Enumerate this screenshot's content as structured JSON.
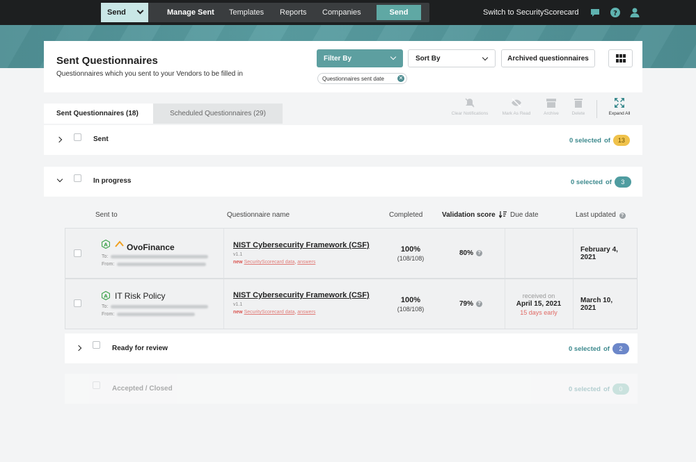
{
  "topnav": {
    "send_dropdown": "Send",
    "links": [
      "Manage Sent",
      "Templates",
      "Reports",
      "Companies"
    ],
    "send_button": "Send",
    "switch_link": "Switch to SecurityScorecard",
    "icons": [
      "chat-icon",
      "help-icon",
      "user-icon"
    ]
  },
  "header": {
    "title": "Sent Questionnaires",
    "subtitle": "Questionnaires which you sent to your Vendors to be filled in",
    "filter_by": "Filter By",
    "sort_by": "Sort By",
    "archived": "Archived questionnaires",
    "filter_chip": "Questionnaires sent date"
  },
  "tabs": {
    "sent": "Sent Questionnaires (18)",
    "scheduled": "Scheduled Questionnaires (29)"
  },
  "toolbar": {
    "clear_notifications": "Clear Notifications",
    "mark_as_read": "Mark As Read",
    "archive": "Archive",
    "delete": "Delete",
    "expand_all": "Expand All"
  },
  "groups": {
    "sent": {
      "label": "Sent",
      "selected": "0 selected",
      "of": "of",
      "count": "13"
    },
    "in_progress": {
      "label": "In progress",
      "selected": "0 selected",
      "of": "of",
      "count": "3"
    },
    "ready": {
      "label": "Ready for review",
      "selected": "0 selected",
      "of": "of",
      "count": "2"
    },
    "accepted": {
      "label": "Accepted / Closed",
      "selected": "0 selected",
      "of": "of",
      "count": "0"
    }
  },
  "table": {
    "headers": {
      "sent_to": "Sent to",
      "questionnaire_name": "Questionnaire name",
      "completed": "Completed",
      "validation_score": "Validation score",
      "due_date": "Due date",
      "last_updated": "Last updated"
    },
    "rows": [
      {
        "vendor_badge": "A",
        "vendor": "OvoFinance",
        "to_label": "To:",
        "from_label": "From:",
        "questionnaire": "NIST Cybersecurity Framework (CSF)",
        "version": "v1.1",
        "new_label": "new",
        "new_link1": "SecurityScorecard data",
        "new_sep": ",",
        "new_link2": "answers",
        "completed_pct": "100%",
        "completed_frac": "(108/108)",
        "score": "80%",
        "due_received": "",
        "due_date": "",
        "due_note": "",
        "last_updated": "February 4, 2021"
      },
      {
        "vendor_badge": "A",
        "vendor": "IT Risk Policy",
        "to_label": "To:",
        "from_label": "From:",
        "questionnaire": "NIST Cybersecurity Framework (CSF)",
        "version": "v1.1",
        "new_label": "new",
        "new_link1": "SecurityScorecard data",
        "new_sep": ",",
        "new_link2": "answers",
        "completed_pct": "100%",
        "completed_frac": "(108/108)",
        "score": "79%",
        "due_received": "received on",
        "due_date": "April 15, 2021",
        "due_note": "15 days early",
        "last_updated": "March 10, 2021"
      }
    ]
  },
  "colors": {
    "accent": "#5d9fa0",
    "pill_sent": "#f0c24b",
    "pill_in_progress": "#4f9ca0",
    "pill_ready": "#6c87c9",
    "pill_accepted": "#7fc3b5"
  }
}
